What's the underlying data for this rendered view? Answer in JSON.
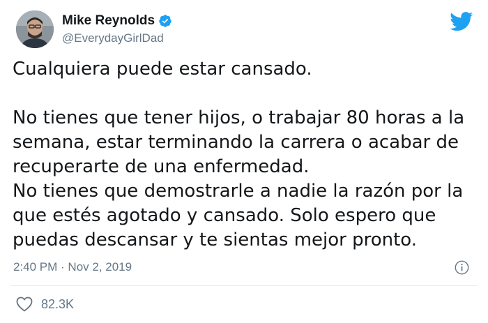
{
  "author": {
    "display_name": "Mike Reynolds",
    "handle": "@EverydayGirlDad",
    "avatar_icon": "user-avatar-photo",
    "verified_icon": "verified-badge-icon"
  },
  "brand": {
    "icon": "twitter-bird-icon",
    "color": "#1da1f2"
  },
  "tweet": {
    "line1": "Cualquiera puede estar cansado.",
    "line2": "No tienes que tener hijos, o trabajar 80 horas a la",
    "line3": "semana, estar terminando la carrera o acabar de",
    "line4": "recuperarte de una enfermedad.",
    "line5": "No tienes que demostrarle a nadie la razón por la",
    "line6": "que estés agotado y cansado. Solo espero que",
    "line7": "puedas descansar y te sientas mejor pronto."
  },
  "meta": {
    "timestamp": "2:40 PM · Nov 2, 2019",
    "info_icon": "info-icon"
  },
  "engagement": {
    "like_icon": "heart-icon",
    "like_count": "82.3K"
  },
  "colors": {
    "text": "#14171a",
    "secondary": "#657786",
    "divider": "#e6ecf0"
  }
}
